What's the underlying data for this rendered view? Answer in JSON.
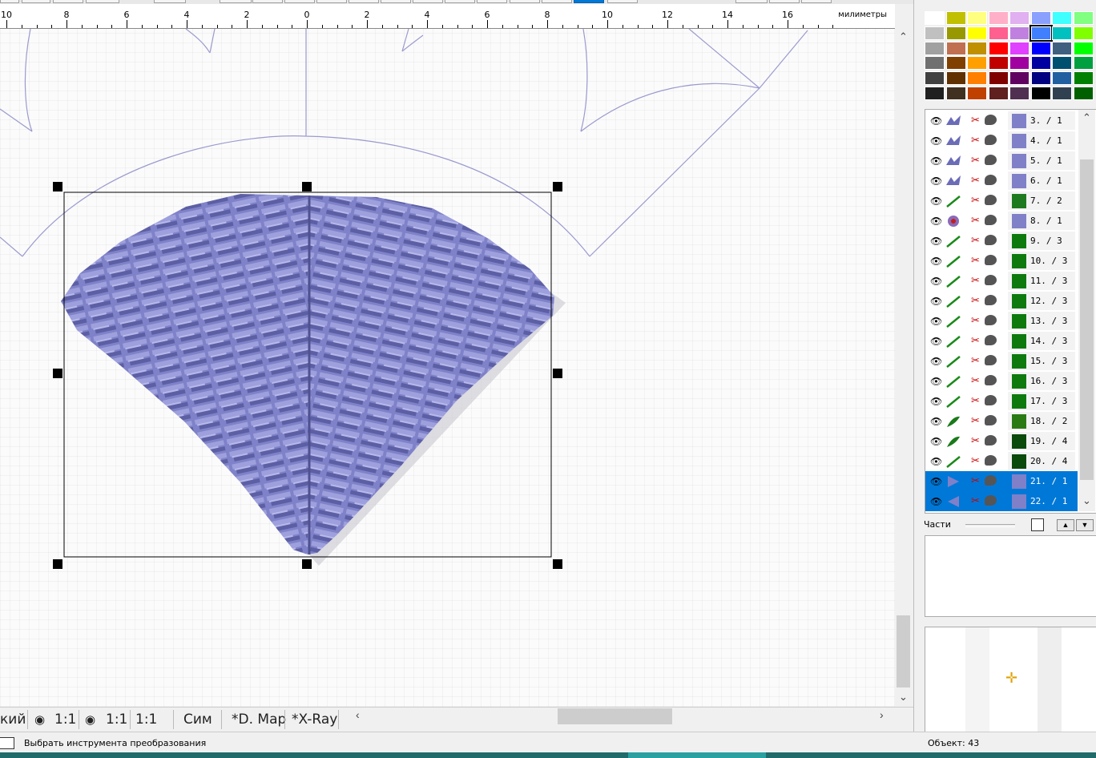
{
  "ruler": {
    "unit": "милиметры",
    "labels": [
      "10",
      "8",
      "6",
      "4",
      "2",
      "0",
      "2",
      "4",
      "6",
      "8",
      "10",
      "12",
      "14",
      "16"
    ]
  },
  "bottom_bar": {
    "items": [
      "кий",
      "1:1",
      "1:1",
      "1:1",
      "Сим",
      "*D. Map",
      "*X-Ray"
    ]
  },
  "status": {
    "tool_text": "Выбрать инструмента преобразования",
    "object_text": "Объект: 43"
  },
  "parts_panel": {
    "label": "Части"
  },
  "objects": [
    {
      "label": "3. / 1",
      "swatch": "#8080c8",
      "thumb": "lavender",
      "selected": false
    },
    {
      "label": "4. / 1",
      "swatch": "#8080c8",
      "thumb": "lavender",
      "selected": false
    },
    {
      "label": "5. / 1",
      "swatch": "#8080c8",
      "thumb": "lavender",
      "selected": false
    },
    {
      "label": "6. / 1",
      "swatch": "#8080c8",
      "thumb": "lavender",
      "selected": false
    },
    {
      "label": "7. / 2",
      "swatch": "#1e7a1e",
      "thumb": "green-line",
      "selected": false
    },
    {
      "label": "8. / 1",
      "swatch": "#8080c8",
      "thumb": "flower",
      "selected": false
    },
    {
      "label": "9. / 3",
      "swatch": "#0e7a0e",
      "thumb": "green-line",
      "selected": false
    },
    {
      "label": "10. / 3",
      "swatch": "#0e7a0e",
      "thumb": "green-line",
      "selected": false
    },
    {
      "label": "11. / 3",
      "swatch": "#0e7a0e",
      "thumb": "green-line",
      "selected": false
    },
    {
      "label": "12. / 3",
      "swatch": "#0e7a0e",
      "thumb": "green-line",
      "selected": false
    },
    {
      "label": "13. / 3",
      "swatch": "#0e7a0e",
      "thumb": "green-line",
      "selected": false
    },
    {
      "label": "14. / 3",
      "swatch": "#0e7a0e",
      "thumb": "green-line",
      "selected": false
    },
    {
      "label": "15. / 3",
      "swatch": "#0e7a0e",
      "thumb": "green-line",
      "selected": false
    },
    {
      "label": "16. / 3",
      "swatch": "#0e7a0e",
      "thumb": "green-line",
      "selected": false
    },
    {
      "label": "17. / 3",
      "swatch": "#0e7a0e",
      "thumb": "green-line",
      "selected": false
    },
    {
      "label": "18. / 2",
      "swatch": "#2a7a14",
      "thumb": "green-leaf",
      "selected": false
    },
    {
      "label": "19. / 4",
      "swatch": "#0a4a0a",
      "thumb": "green-leaf",
      "selected": false
    },
    {
      "label": "20. / 4",
      "swatch": "#0a4a0a",
      "thumb": "green-line",
      "selected": false
    },
    {
      "label": "21. / 1",
      "swatch": "#8080c8",
      "thumb": "triangle-right",
      "selected": true
    },
    {
      "label": "22. / 1",
      "swatch": "#8080c8",
      "thumb": "triangle-left",
      "selected": true
    }
  ],
  "palette_colors": [
    [
      "#ffffff",
      "#c0c000",
      "#ffff80",
      "#ffb0c8",
      "#e0b0f0",
      "#8aa0ff",
      "#40ffff",
      "#80ff80"
    ],
    [
      "#c0c0c0",
      "#989800",
      "#ffff00",
      "#ff6090",
      "#c080e0",
      "#4080ff",
      "#00c0c0",
      "#80ff00"
    ],
    [
      "#a0a0a0",
      "#c07050",
      "#c09000",
      "#ff0000",
      "#e040ff",
      "#0000ff",
      "#406080",
      "#00ff00"
    ],
    [
      "#707070",
      "#804000",
      "#ffa000",
      "#c00000",
      "#a000a0",
      "#0000a0",
      "#005070",
      "#00a040"
    ],
    [
      "#404040",
      "#603000",
      "#ff8000",
      "#800000",
      "#600060",
      "#000080",
      "#2060a0",
      "#008000"
    ],
    [
      "#202020",
      "#403020",
      "#c04000",
      "#602020",
      "#503050",
      "#000000",
      "#304050",
      "#006000"
    ]
  ],
  "colors": {
    "selection_blue": "#0078d7",
    "stitch_lavender": "#7f82c8",
    "design_outline": "#9a9ad0"
  }
}
